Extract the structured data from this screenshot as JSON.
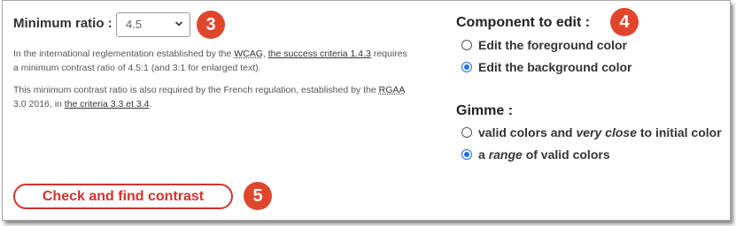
{
  "minimum_ratio": {
    "label": "Minimum ratio :",
    "selected_value": "4.5"
  },
  "badges": {
    "three": "3",
    "four": "4",
    "five": "5"
  },
  "info_paragraph_1": {
    "text_1": "In the international reglementation established by the ",
    "link_wcag": "WCAG",
    "text_2": ", ",
    "link_success_criteria": "the success criteria 1.4.3",
    "text_3": " requires a minimum contrast ratio of 4.5:1 (and 3:1 for enlarged text)."
  },
  "info_paragraph_2": {
    "text_1": "This minimum contrast ratio is also required by the French regulation, established by the ",
    "abbr_rgaa": "RGAA",
    "text_2": " 3.0 2016, in ",
    "link_criteria": "the criteria 3.3 et 3.4",
    "text_3": "."
  },
  "component_to_edit": {
    "heading": "Component to edit :",
    "options": [
      {
        "label": "Edit the foreground color",
        "checked": false
      },
      {
        "label": "Edit the background color",
        "checked": true
      }
    ]
  },
  "gimme": {
    "heading": "Gimme :",
    "option_1": {
      "prefix": "valid colors and ",
      "emphasis": "very close",
      "suffix": " to initial color",
      "checked": false
    },
    "option_2": {
      "prefix": "a ",
      "emphasis": "range",
      "suffix": " of valid colors",
      "checked": true
    }
  },
  "check_button_label": "Check and find contrast",
  "colors": {
    "badge": "#e0462c",
    "button_border": "#d3322b",
    "radio_checked": "#1a73e8"
  }
}
